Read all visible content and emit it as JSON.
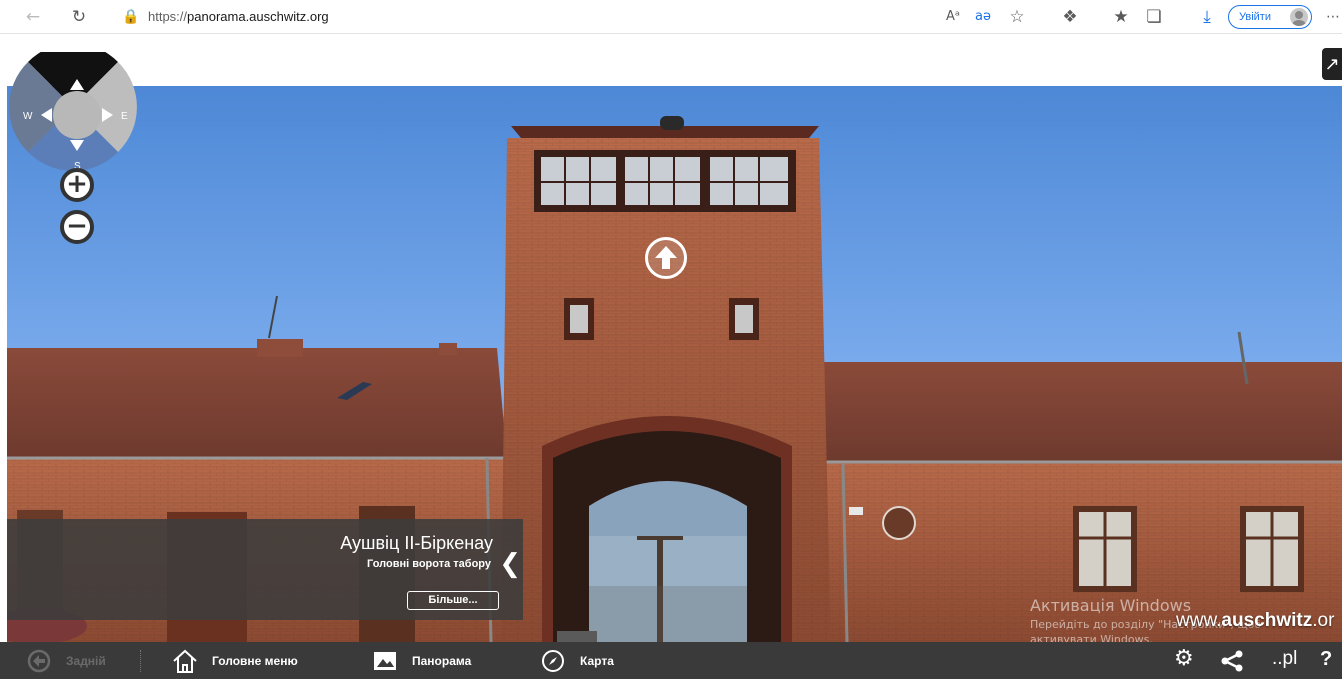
{
  "browser": {
    "url_prefix": "https://",
    "url_domain": "panorama.auschwitz.org",
    "read_aloud_icon": "Aᵃ",
    "translate_icon": "aə",
    "signin_label": "Увійти"
  },
  "compass": {
    "west": "W",
    "east": "E",
    "south": "S"
  },
  "zoom": {
    "in": "+",
    "out": "−"
  },
  "info_panel": {
    "title": "Аушвіц II-Біркенау",
    "subtitle": "Головні ворота табору",
    "more_button": "Більше...",
    "collapse": "❮"
  },
  "watermark": {
    "line1": "Активація Windows",
    "line2": "Перейдіть до розділу \"Настройки\", щоб активувати Windows."
  },
  "site": {
    "prefix": "www.",
    "brand": "auschwitz",
    "suffix": ".or"
  },
  "bottom_nav": {
    "back": "Задній",
    "home": "Головне меню",
    "panorama": "Панорама",
    "map": "Карта",
    "lang": "..pl",
    "help": "?"
  },
  "icons": [
    "back-arrow-icon",
    "refresh-icon",
    "lock-icon",
    "read-aloud-icon",
    "translate-icon",
    "favorite-icon",
    "extensions-icon",
    "favorites-icon",
    "collections-icon",
    "download-icon",
    "avatar",
    "more-icon",
    "home-icon",
    "panorama-icon",
    "compass-icon",
    "settings-gear-icon",
    "share-icon",
    "help-icon",
    "fullscreen-icon",
    "up-arrow-icon"
  ]
}
